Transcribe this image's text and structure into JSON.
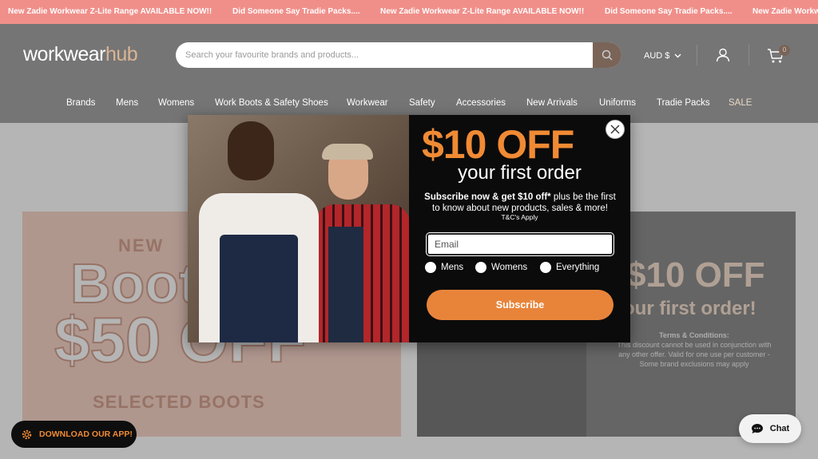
{
  "announcement": {
    "messages": [
      "New Zadie Workwear Z-Lite Range AVAILABLE NOW!!",
      "Did Someone Say Tradie Packs....",
      "New Zadie Workwear Z-Lite Range AVAILABLE NOW!!",
      "Did Someone Say Tradie Packs....",
      "New Zadie Workwear Z-Lite Range AVAILABLE NOW!!"
    ]
  },
  "header": {
    "logo_part1": "workwear",
    "logo_part2": "hub",
    "search_placeholder": "Search your favourite brands and products...",
    "currency": "AUD $",
    "cart_count": "0"
  },
  "nav": {
    "items": [
      "Brands",
      "Mens",
      "Womens",
      "Work Boots & Safety Shoes",
      "Workwear",
      "Safety",
      "Accessories",
      "New Arrivals",
      "Uniforms",
      "Tradie Packs",
      "SALE"
    ]
  },
  "banners": {
    "left": {
      "line1": "NEW",
      "line2": "Boots",
      "line3": "$50 OFF",
      "line4": "SELECTED BOOTS"
    },
    "right": {
      "headline": "$10 OFF",
      "subheadline": "our first order!",
      "terms_title": "Terms & Conditions:",
      "terms_text": "This discount cannot be used in conjunction with any other offer. Valid for one use per customer - Some brand exclusions may apply"
    }
  },
  "popup": {
    "headline": "$10 OFF",
    "subheadline": "your first order",
    "desc_bold": "Subscribe now & get $10 off*",
    "desc_rest": " plus be the first to know about new products, sales & more!",
    "tc": "T&C's Apply",
    "email_placeholder": "Email",
    "options": [
      "Mens",
      "Womens",
      "Everything"
    ],
    "subscribe_label": "Subscribe"
  },
  "widgets": {
    "app_label": "DOWNLOAD OUR APP!",
    "chat_label": "Chat"
  },
  "colors": {
    "announcement_bg": "#f08f8a",
    "accent_orange": "#f08a34",
    "popup_bg": "#0b0b0b"
  }
}
